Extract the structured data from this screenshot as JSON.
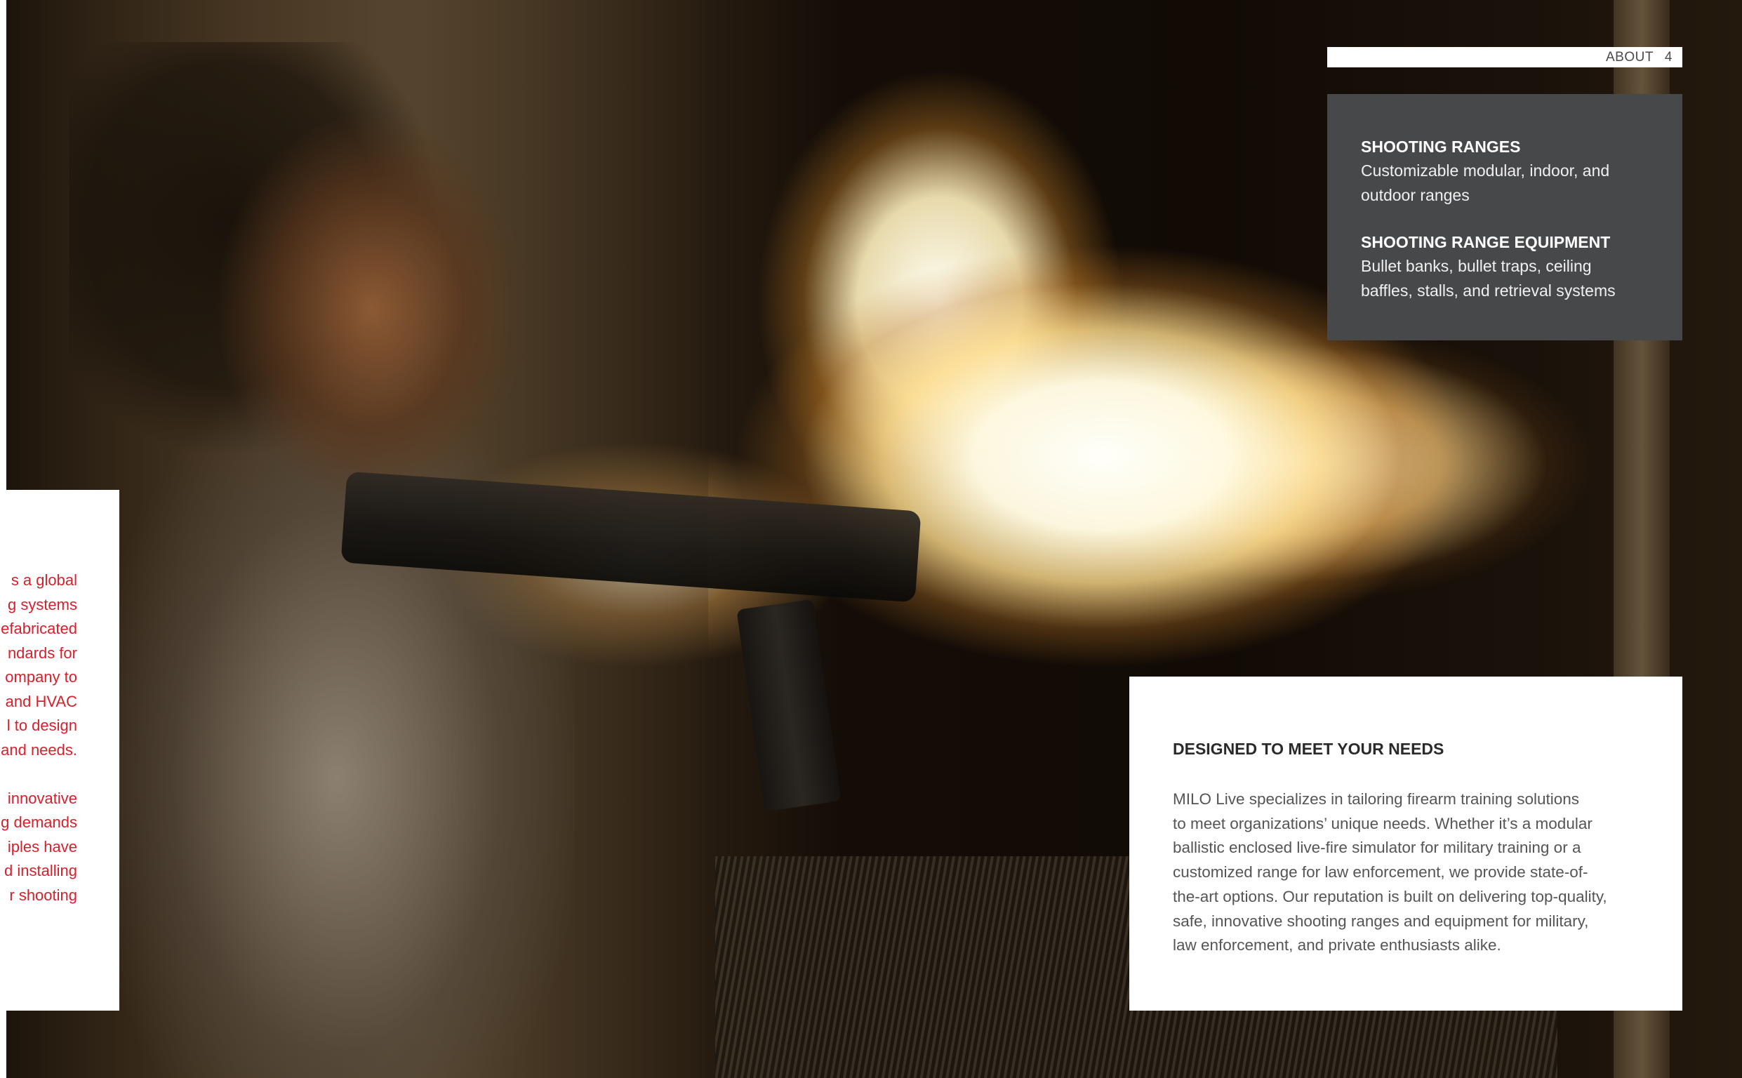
{
  "page_label": {
    "section": "ABOUT",
    "page_number": "4"
  },
  "info_box": {
    "items": [
      {
        "title": "SHOOTING RANGES",
        "lines": [
          "Customizable modular, indoor, and",
          "outdoor ranges"
        ]
      },
      {
        "title": "SHOOTING RANGE EQUIPMENT",
        "lines": [
          "Bullet banks, bullet traps, ceiling",
          "baffles, stalls, and retrieval systems"
        ]
      }
    ]
  },
  "left_card": {
    "paragraphs": [
      [
        "s a global",
        "g systems",
        "efabricated",
        "ndards for",
        "ompany to",
        ", and HVAC",
        "l to design",
        "and needs."
      ],
      [
        "innovative",
        "g demands",
        "iples have",
        "d installing",
        "r shooting"
      ]
    ]
  },
  "needs_card": {
    "title": "DESIGNED TO MEET YOUR NEEDS",
    "lines": [
      "MILO Live specializes in tailoring firearm training solutions",
      "to meet organizations’ unique needs. Whether it’s a modular",
      "ballistic enclosed live-fire simulator for military training or a",
      "customized range for law enforcement, we provide state-of-",
      "the-art options. Our reputation is built on delivering top-quality,",
      "safe, innovative shooting ranges and equipment for military,",
      "law enforcement, and private enthusiasts alike."
    ]
  },
  "colors": {
    "accent_red": "#d7202c",
    "info_box_bg": "#47484a",
    "body_text": "#555555"
  }
}
